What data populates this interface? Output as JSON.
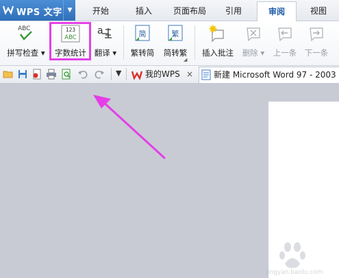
{
  "app": {
    "name": "WPS 文字",
    "brand_color": "#3b7dcc"
  },
  "tabs": [
    {
      "label": "开始"
    },
    {
      "label": "插入"
    },
    {
      "label": "页面布局"
    },
    {
      "label": "引用"
    },
    {
      "label": "审阅",
      "active": true
    },
    {
      "label": "视图"
    }
  ],
  "ribbon": {
    "spell_check": "拼写检查",
    "word_count": "字数统计",
    "word_count_icon_top": "123",
    "word_count_icon_bottom": "ABC",
    "spell_icon_text": "ABC",
    "translate": "翻译",
    "trad_to_simp": "繁转简",
    "simp_to_trad": "简转繁",
    "trad_icon": "简",
    "simp_icon": "繁",
    "insert_comment": "插入批注",
    "delete": "删除",
    "prev": "上一条",
    "next": "下一条"
  },
  "quickbar": {
    "tab_my_wps": "我的WPS",
    "tab_doc": "新建 Microsoft Word 97 - 2003"
  },
  "watermark": {
    "text": "jingyan.baidu.com"
  },
  "colors": {
    "highlight": "#e341e8",
    "arrow": "#e53ee8"
  }
}
